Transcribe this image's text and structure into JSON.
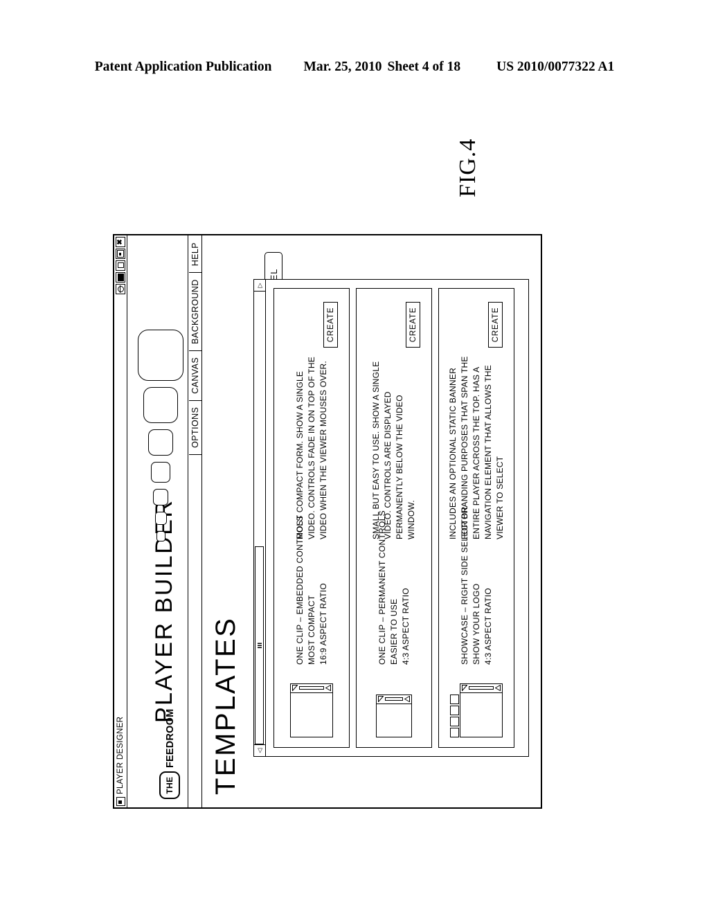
{
  "patent_header": {
    "publication": "Patent Application Publication",
    "date": "Mar. 25, 2010",
    "sheet": "Sheet 4 of 18",
    "number": "US 2010/0077322 A1"
  },
  "figure": {
    "label": "FIG.4"
  },
  "window": {
    "title": "PLAYER DESIGNER",
    "controls": [
      {
        "name": "help-button",
        "glyph": "?"
      },
      {
        "name": "camera-button",
        "glyph": "camera"
      },
      {
        "name": "minimize-button",
        "glyph": "minimize"
      },
      {
        "name": "maximize-button",
        "glyph": "maximize"
      },
      {
        "name": "close-button",
        "glyph": "×"
      }
    ]
  },
  "brand": {
    "logo_badge": "THE",
    "logo_word": "FEEDROOM",
    "app_title": "PLAYER BUILDER"
  },
  "menu": {
    "items": [
      "OPTIONS",
      "CANVAS",
      "BACKGROUND",
      "HELP"
    ]
  },
  "page": {
    "section_title": "TEMPLATES"
  },
  "scrollbar": {
    "left_arrow": "◁",
    "right_arrow": "▷"
  },
  "templates": [
    {
      "title": "ONE CLIP – EMBEDDED CONTROLS",
      "subtitle": "MOST COMPACT",
      "aspect": "16:9 ASPECT RATIO",
      "description": "MOST COMPACT FORM. SHOW A SINGLE VIDEO. CONTROLS FADE IN ON TOP OF THE VIDEO WHEN THE VIEWER MOUSES OVER.",
      "button": "CREATE",
      "thumb_variant": "plain"
    },
    {
      "title": "ONE CLIP – PERMANENT CONTROLS",
      "subtitle": "EASIER TO USE",
      "aspect": "4:3 ASPECT RATIO",
      "description": "SMALL BUT EASY TO USE. SHOW A SINGLE VIDEO. CONTROLS ARE DISPLAYED PERMANENTLY BELOW THE VIDEO WINDOW.",
      "button": "CREATE",
      "thumb_variant": "plain-small"
    },
    {
      "title": "SHOWCASE – RIGHT SIDE SELECTOR",
      "subtitle": "SHOW YOUR LOGO",
      "aspect": "4:3 ASPECT RATIO",
      "description": "INCLUDES AN OPTIONAL STATIC BANNER FOR BRANDING PURPOSES THAT SPAN THE ENTIRE PLAYER ACROSS THE TOP. HAS A NAVIGATION ELEMENT THAT ALLOWS THE VIEWER TO SELECT",
      "button": "CREATE",
      "thumb_variant": "selector"
    }
  ],
  "actions": {
    "cancel": "CANCEL"
  },
  "colors": {
    "line": "#000000",
    "background": "#ffffff"
  }
}
